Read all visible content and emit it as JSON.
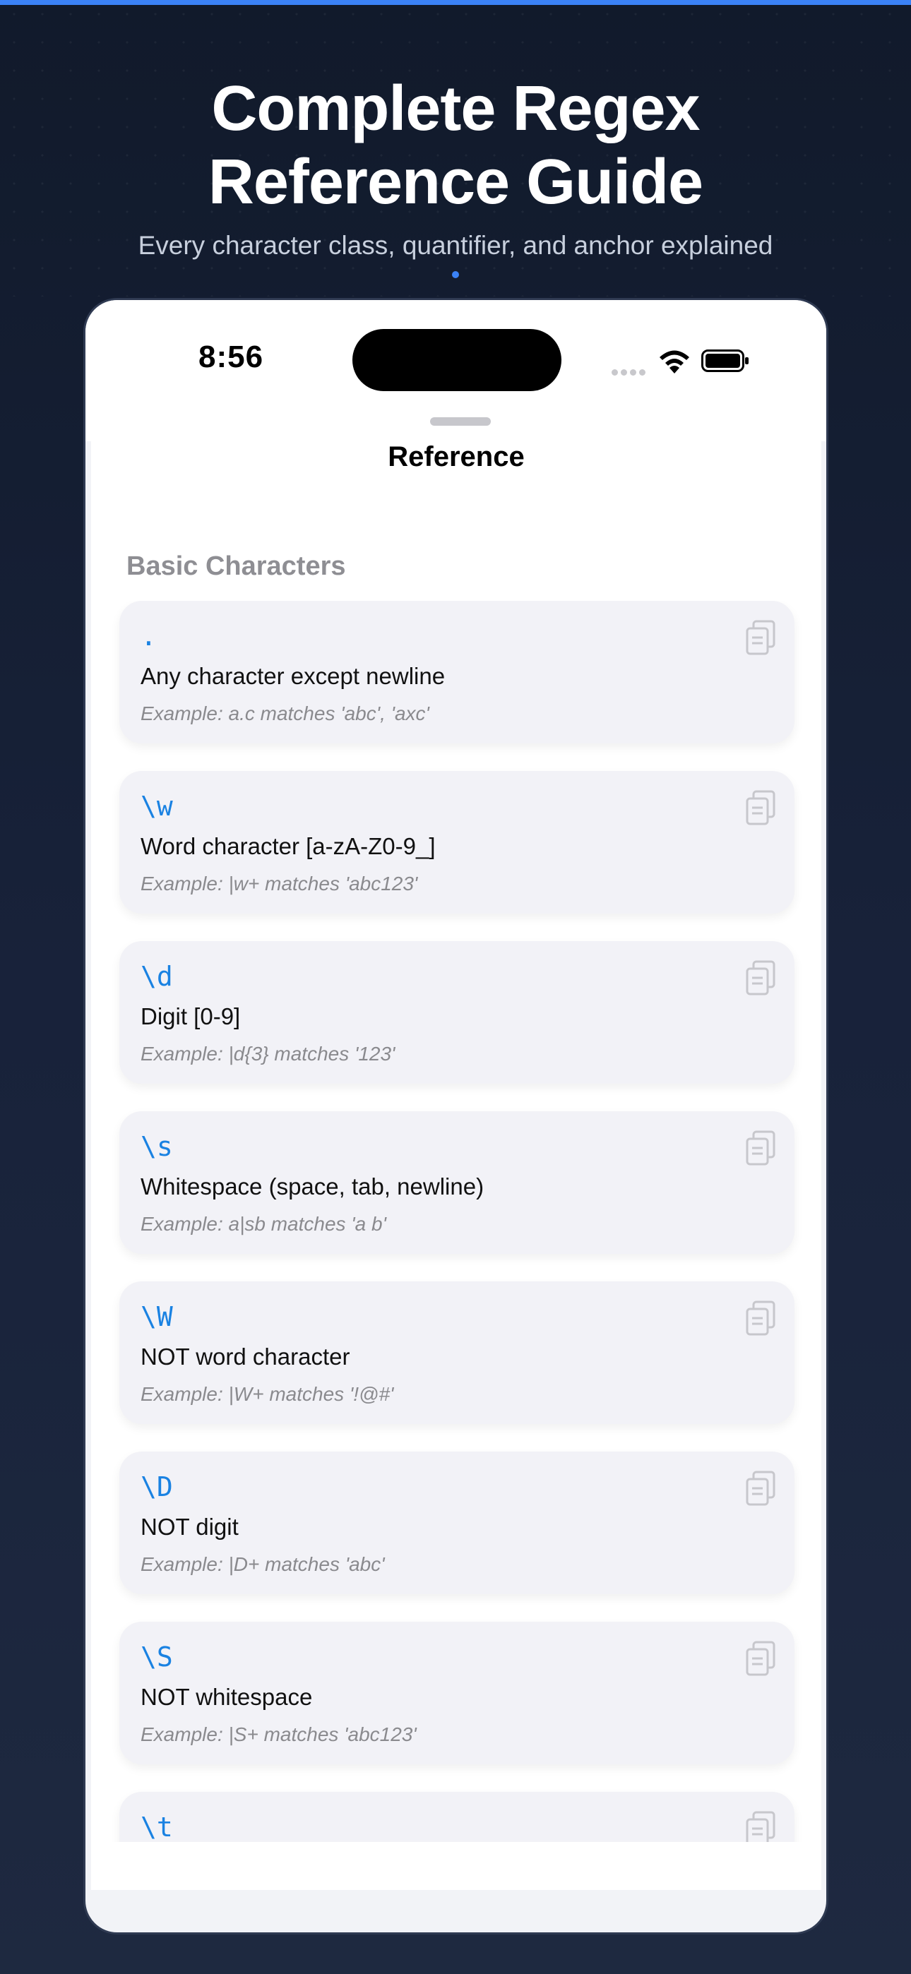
{
  "header": {
    "title_line1": "Complete Regex",
    "title_line2": "Reference Guide",
    "subtitle": "Every character class, quantifier, and anchor explained"
  },
  "status_bar": {
    "time": "8:56"
  },
  "sheet": {
    "title": "Reference"
  },
  "section": {
    "title": "Basic Characters",
    "items": [
      {
        "code": ".",
        "description": "Any character except newline",
        "example": "Example: a.c matches 'abc', 'axc'"
      },
      {
        "code": "\\w",
        "description": "Word character [a-zA-Z0-9_]",
        "example": "Example: |w+ matches 'abc123'"
      },
      {
        "code": "\\d",
        "description": "Digit [0-9]",
        "example": "Example: |d{3} matches '123'"
      },
      {
        "code": "\\s",
        "description": "Whitespace (space, tab, newline)",
        "example": "Example: a|sb matches 'a b'"
      },
      {
        "code": "\\W",
        "description": "NOT word character",
        "example": "Example: |W+ matches '!@#'"
      },
      {
        "code": "\\D",
        "description": "NOT digit",
        "example": "Example: |D+ matches 'abc'"
      },
      {
        "code": "\\S",
        "description": "NOT whitespace",
        "example": "Example: |S+ matches 'abc123'"
      },
      {
        "code": "\\t",
        "description": "",
        "example": ""
      }
    ]
  },
  "colors": {
    "accent": "#1a82e2",
    "top_bar": "#3b82f6",
    "background": "#111a2b"
  },
  "icons": {
    "copy": "copy-icon",
    "wifi": "wifi-icon",
    "battery": "battery-icon"
  }
}
